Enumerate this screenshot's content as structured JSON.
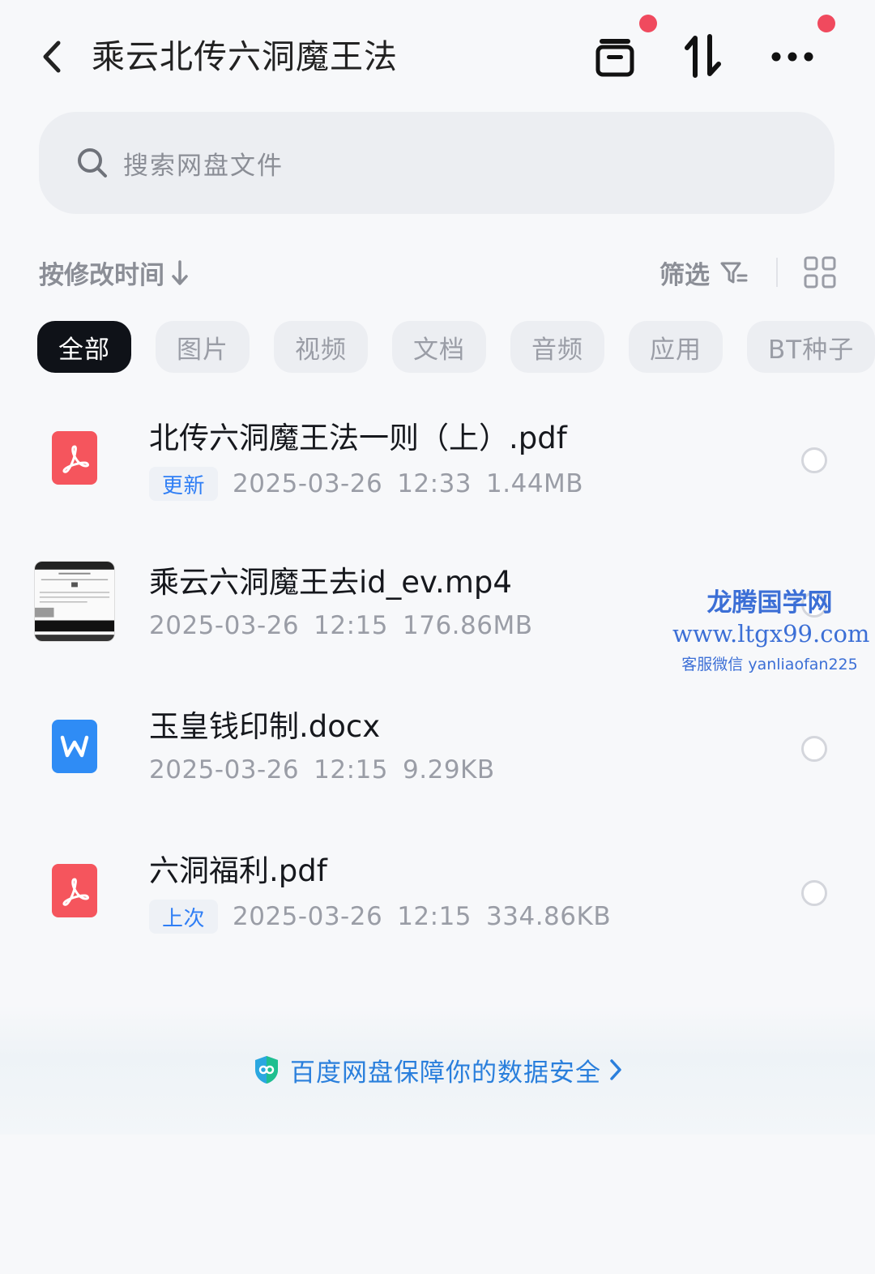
{
  "header": {
    "title": "乘云北传六洞魔王法"
  },
  "search": {
    "placeholder": "搜索网盘文件"
  },
  "sortbar": {
    "sort_label": "按修改时间",
    "filter_label": "筛选"
  },
  "categories": [
    {
      "label": "全部",
      "active": true
    },
    {
      "label": "图片",
      "active": false
    },
    {
      "label": "视频",
      "active": false
    },
    {
      "label": "文档",
      "active": false
    },
    {
      "label": "音频",
      "active": false
    },
    {
      "label": "应用",
      "active": false
    },
    {
      "label": "BT种子",
      "active": false
    }
  ],
  "files": [
    {
      "name": "北传六洞魔王法一则（上）.pdf",
      "badge": "更新",
      "date": "2025-03-26",
      "time": "12:33",
      "size": "1.44MB",
      "type": "pdf-icon"
    },
    {
      "name": "乘云六洞魔王去id_ev.mp4",
      "badge": "",
      "date": "2025-03-26",
      "time": "12:15",
      "size": "176.86MB",
      "type": "video-thumbnail"
    },
    {
      "name": "玉皇钱印制.docx",
      "badge": "",
      "date": "2025-03-26",
      "time": "12:15",
      "size": "9.29KB",
      "type": "word-icon"
    },
    {
      "name": "六洞福利.pdf",
      "badge": "上次",
      "date": "2025-03-26",
      "time": "12:15",
      "size": "334.86KB",
      "type": "pdf-icon"
    }
  ],
  "watermark": {
    "title": "龙腾国学网",
    "url": "www.ltgx99.com",
    "sub": "客服微信 yanliaofan225"
  },
  "security": {
    "text": "百度网盘保障你的数据安全"
  },
  "colors": {
    "accent_blue": "#2f7ef5",
    "notification_dot": "#f04a5e",
    "pdf_red": "#f5555d",
    "word_blue": "#2f8cf5",
    "active_chip": "#0f1218"
  }
}
